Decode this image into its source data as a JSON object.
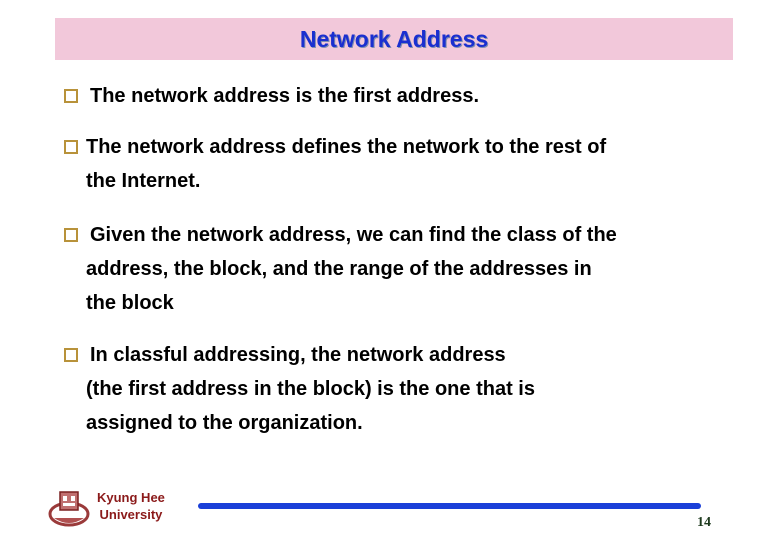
{
  "slide": {
    "title": "Network Address",
    "bullets": [
      {
        "lines": [
          "The network address is the first address."
        ]
      },
      {
        "lines": [
          "The network address defines the network to the rest of",
          "the Internet."
        ]
      },
      {
        "lines": [
          "Given the network address, we can find the class of the",
          "address, the block, and the range of the addresses in",
          "the block"
        ]
      },
      {
        "lines": [
          "In classful addressing, the network address",
          "(the first address in the block) is the one that is",
          "assigned to the organization."
        ]
      }
    ]
  },
  "footer": {
    "university_line1": "Kyung Hee",
    "university_line2": "University",
    "page_number": "14",
    "logo_icon": "university-seal-icon"
  },
  "colors": {
    "title_bg": "#f2c8da",
    "title_text": "#1a2fd0",
    "bullet_box": "#b8923a",
    "footer_bar": "#1a3fd8",
    "university_text": "#8b1a1a"
  }
}
